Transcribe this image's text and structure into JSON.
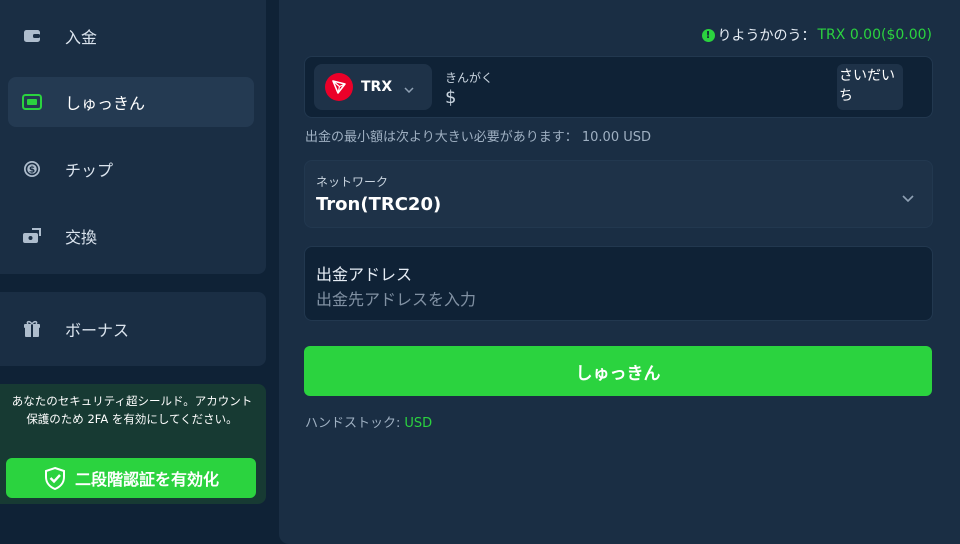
{
  "sidebar": {
    "items": [
      {
        "label": "入金",
        "icon": "wallet-icon"
      },
      {
        "label": "しゅっきん",
        "icon": "withdraw-icon",
        "active": true
      },
      {
        "label": "チップ",
        "icon": "coin-icon"
      },
      {
        "label": "交換",
        "icon": "exchange-icon"
      }
    ],
    "bonus": {
      "label": "ボーナス",
      "icon": "gift-icon"
    },
    "security": {
      "text": "あなたのセキュリティ超シールド。アカウント保護のため 2FA を有効にしてください。",
      "button_label": "二段階認証を有効化",
      "icon": "shield-check-icon"
    }
  },
  "main": {
    "balance": {
      "label": "りようかのう：",
      "value": "TRX 0.00($0.00)"
    },
    "amount": {
      "coin": "TRX",
      "label": "きんがく",
      "currency_symbol": "$",
      "max_label": "さいだいち"
    },
    "minimum_text": "出金の最小額は次より大きい必要があります： 10.00 USD",
    "network": {
      "label": "ネットワーク",
      "value": "Tron(TRC20)"
    },
    "address": {
      "label": "出金アドレス",
      "placeholder": "出金先アドレスを入力"
    },
    "submit_label": "しゅっきん",
    "handstock": {
      "label": "ハンドストック:",
      "value": "USD"
    }
  },
  "colors": {
    "accent": "#2bd33f",
    "background": "#0f2236",
    "panel": "#1a2e44",
    "trx": "#eb0029"
  }
}
